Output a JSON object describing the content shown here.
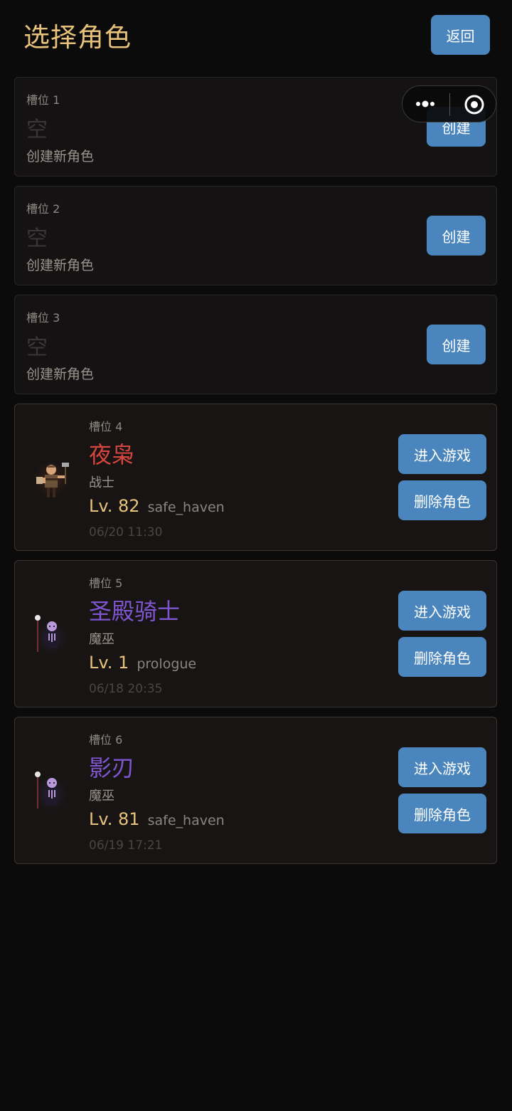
{
  "header": {
    "title": "选择角色",
    "back_label": "返回"
  },
  "capsule": {
    "more_icon": "more-dots-icon",
    "close_icon": "target-circle-icon"
  },
  "empty_slots": [
    {
      "label": "槽位 1",
      "empty_text": "空",
      "desc": "创建新角色",
      "button": "创建"
    },
    {
      "label": "槽位 2",
      "empty_text": "空",
      "desc": "创建新角色",
      "button": "创建"
    },
    {
      "label": "槽位 3",
      "empty_text": "空",
      "desc": "创建新角色",
      "button": "创建"
    }
  ],
  "characters": [
    {
      "label": "槽位 4",
      "name": "夜枭",
      "name_color": "#d6453e",
      "class": "战士",
      "level": "Lv. 82",
      "location": "safe_haven",
      "time": "06/20 11:30",
      "enter": "进入游戏",
      "delete": "删除角色",
      "avatar": "warrior-avatar-icon"
    },
    {
      "label": "槽位 5",
      "name": "圣殿骑士",
      "name_color": "#7e56d0",
      "class": "魔巫",
      "level": "Lv. 1",
      "location": "prologue",
      "time": "06/18 20:35",
      "enter": "进入游戏",
      "delete": "删除角色",
      "avatar": "mage-avatar-icon"
    },
    {
      "label": "槽位 6",
      "name": "影刃",
      "name_color": "#7e56d0",
      "class": "魔巫",
      "level": "Lv. 81",
      "location": "safe_haven",
      "time": "06/19 17:21",
      "enter": "进入游戏",
      "delete": "删除角色",
      "avatar": "mage-avatar-icon"
    }
  ],
  "colors": {
    "background": "#0c0b0b",
    "accent_gold": "#e7c27b",
    "button_blue": "#4a86bd"
  }
}
